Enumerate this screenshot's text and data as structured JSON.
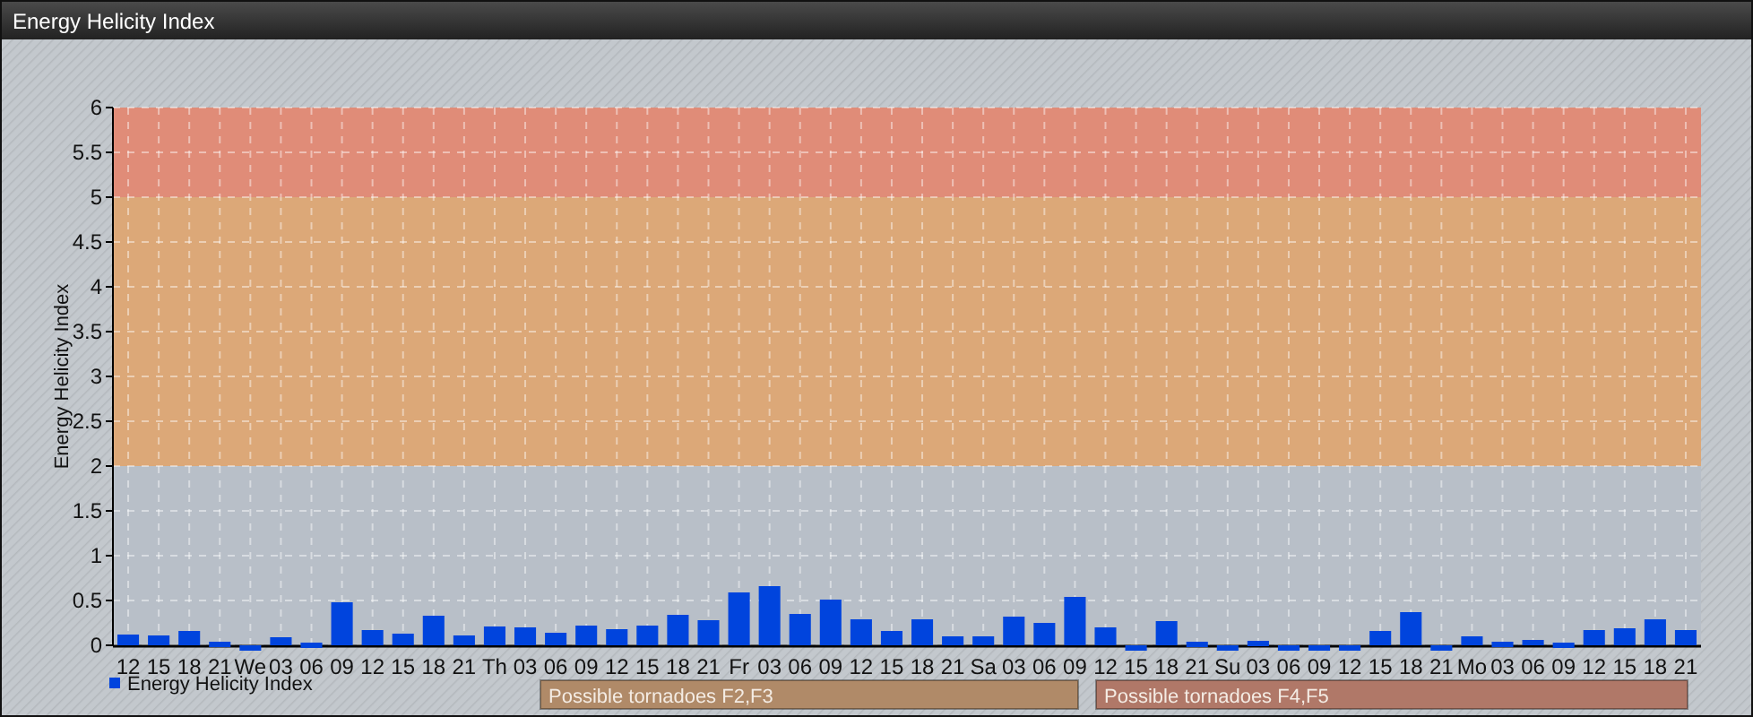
{
  "window": {
    "title": "Energy Helicity Index"
  },
  "chart": {
    "chart_data": {
      "type": "bar",
      "ylabel": "Energy Helicity Index",
      "ylim": [
        -0.1,
        6
      ],
      "yticks": [
        0,
        0.5,
        1,
        1.5,
        2,
        2.5,
        3,
        3.5,
        4,
        4.5,
        5,
        5.5,
        6
      ],
      "categories": [
        "12",
        "15",
        "18",
        "21",
        "We",
        "03",
        "06",
        "09",
        "12",
        "15",
        "18",
        "21",
        "Th",
        "03",
        "06",
        "09",
        "12",
        "15",
        "18",
        "21",
        "Fr",
        "03",
        "06",
        "09",
        "12",
        "15",
        "18",
        "21",
        "Sa",
        "03",
        "06",
        "09",
        "12",
        "15",
        "18",
        "21",
        "Su",
        "03",
        "06",
        "09",
        "12",
        "15",
        "18",
        "21",
        "Mo",
        "03",
        "06",
        "09",
        "12",
        "15",
        "18",
        "21"
      ],
      "series": [
        {
          "name": "Energy Helicity Index",
          "color": "#0044dd",
          "values": [
            0.12,
            0.11,
            0.16,
            0.04,
            -0.06,
            0.09,
            0.03,
            0.48,
            0.17,
            0.13,
            0.33,
            0.11,
            0.21,
            0.2,
            0.14,
            0.22,
            0.18,
            0.22,
            0.34,
            0.28,
            0.59,
            0.66,
            0.35,
            0.51,
            0.29,
            0.16,
            0.29,
            0.1,
            0.1,
            0.32,
            0.25,
            0.54,
            0.2,
            -0.03,
            0.27,
            0.04,
            -0.04,
            0.05,
            -0.03,
            -0.05,
            -0.03,
            0.16,
            0.37,
            -0.03,
            0.1,
            0.04,
            0.06,
            0.03,
            0.17,
            0.19,
            0.29,
            0.17
          ]
        }
      ],
      "grid": true,
      "bands": [
        {
          "axis": "y",
          "from": 0,
          "to": 2,
          "color": "#b8bfc8"
        },
        {
          "axis": "y",
          "from": 2,
          "to": 5,
          "color": "#dca878"
        },
        {
          "axis": "y",
          "from": 5,
          "to": 6,
          "color": "#e08c78"
        }
      ]
    },
    "band_legend": [
      {
        "label": "Possible tornadoes F2,F3",
        "color": "#b08a68"
      },
      {
        "label": "Possible tornadoes F4,F5",
        "color": "#b07868"
      }
    ]
  }
}
